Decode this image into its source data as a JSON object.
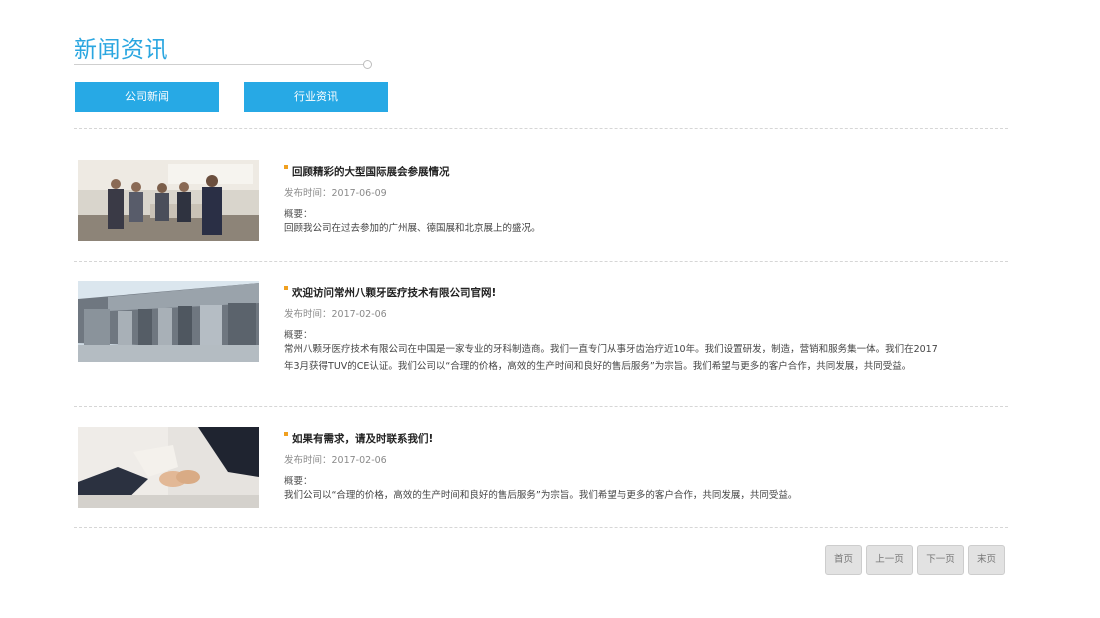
{
  "section": {
    "title": "新闻资讯"
  },
  "tabs": [
    {
      "label": "公司新闻"
    },
    {
      "label": "行业资讯"
    }
  ],
  "news": [
    {
      "title": "回顾精彩的大型国际展会参展情况",
      "date": "发布时间：2017-06-09",
      "summary_label": "概要：",
      "summary": "回顾我公司在过去参加的广州展、德国展和北京展上的盛况。"
    },
    {
      "title": "欢迎访问常州八颗牙医疗技术有限公司官网!",
      "date": "发布时间：2017-02-06",
      "summary_label": "概要：",
      "summary": "常州八颗牙医疗技术有限公司在中国是一家专业的牙科制造商。我们一直专门从事牙齿治疗近10年。我们设置研发，制造，营销和服务集一体。我们在2017年3月获得TUV的CE认证。我们公司以“合理的价格，高效的生产时间和良好的售后服务”为宗旨。我们希望与更多的客户合作，共同发展，共同受益。"
    },
    {
      "title": "如果有需求，请及时联系我们!",
      "date": "发布时间：2017-02-06",
      "summary_label": "概要：",
      "summary": "我们公司以“合理的价格，高效的生产时间和良好的售后服务”为宗旨。我们希望与更多的客户合作，共同发展，共同受益。"
    }
  ],
  "pagination": {
    "first": "首页",
    "prev": "上一页",
    "next": "下一页",
    "last": "末页"
  },
  "colors": {
    "accent": "#27a9e5",
    "title": "#2aa6e0",
    "bullet": "#f0a020"
  }
}
